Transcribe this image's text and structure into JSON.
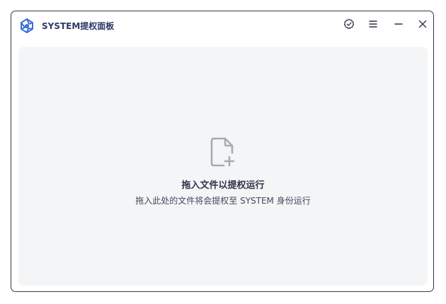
{
  "window": {
    "title": "SYSTEM提权面板"
  },
  "titlebar": {
    "buttons": [
      {
        "name": "verify",
        "icon": "badge-check-icon"
      },
      {
        "name": "menu",
        "icon": "hamburger-menu-icon"
      },
      {
        "name": "minimize",
        "icon": "minimize-icon"
      },
      {
        "name": "close",
        "icon": "close-icon"
      }
    ]
  },
  "dropzone": {
    "icon": "file-add-icon",
    "title": "拖入文件以提权运行",
    "subtitle": "拖入此处的文件将会提权至 SYSTEM 身份运行"
  },
  "colors": {
    "accent": "#3b6fd8",
    "title_text": "#2f3a66",
    "content_bg": "#f4f5f7",
    "icon_gray": "#a9abb3"
  }
}
